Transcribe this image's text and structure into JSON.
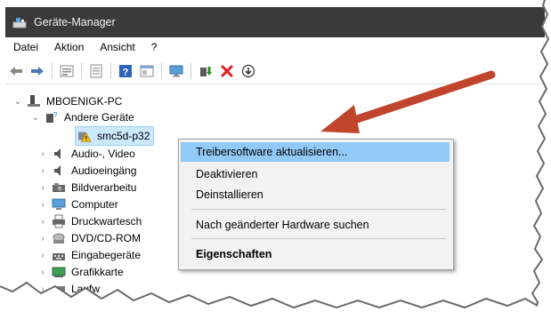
{
  "window": {
    "title": "Geräte-Manager",
    "icon": "device-manager-icon"
  },
  "menubar": {
    "items": [
      "Datei",
      "Aktion",
      "Ansicht",
      "?"
    ]
  },
  "toolbar": {
    "buttons": [
      "back-icon",
      "forward-icon",
      "properties-icon",
      "list-icon",
      "help-icon",
      "view-icon",
      "monitor-icon",
      "update-driver-icon",
      "uninstall-icon",
      "scan-icon"
    ],
    "accent_red": "#e0201f",
    "accent_green": "#2d8b2d"
  },
  "tree": {
    "root": "MBOENIGK-PC",
    "other_devices": "Andere Geräte",
    "selected_device": "smc5d-p32",
    "categories": [
      "Audio-, Video",
      "Audioeingäng",
      "Bildverarbeitu",
      "Computer",
      "Druckwartesch",
      "DVD/CD-ROM",
      "Eingabegeräte",
      "Grafikkarte",
      "Laufw"
    ]
  },
  "context_menu": {
    "items": [
      "Treibersoftware aktualisieren...",
      "Deaktivieren",
      "Deinstallieren",
      "Nach geänderter Hardware suchen",
      "Eigenschaften"
    ],
    "highlight_color": "#91c9f7"
  },
  "annotation": {
    "arrow_color": "#c0452c"
  }
}
